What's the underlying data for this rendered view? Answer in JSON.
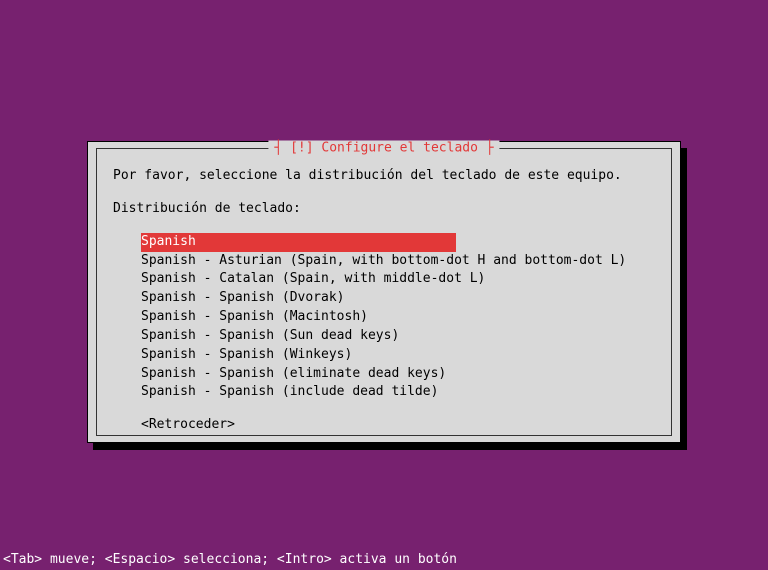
{
  "dialog": {
    "title_left_dash": "┤ ",
    "title_right_dash": " ├",
    "title": "[!] Configure el teclado",
    "prompt": "Por favor, seleccione la distribución del teclado de este equipo.",
    "label": "Distribución de teclado:",
    "options": [
      "Spanish",
      "Spanish - Asturian (Spain, with bottom-dot H and bottom-dot L)",
      "Spanish - Catalan (Spain, with middle-dot L)",
      "Spanish - Spanish (Dvorak)",
      "Spanish - Spanish (Macintosh)",
      "Spanish - Spanish (Sun dead keys)",
      "Spanish - Spanish (Winkeys)",
      "Spanish - Spanish (eliminate dead keys)",
      "Spanish - Spanish (include dead tilde)"
    ],
    "selected_index": 0,
    "back": "<Retroceder>"
  },
  "footer": "<Tab> mueve; <Espacio> selecciona; <Intro> activa un botón"
}
